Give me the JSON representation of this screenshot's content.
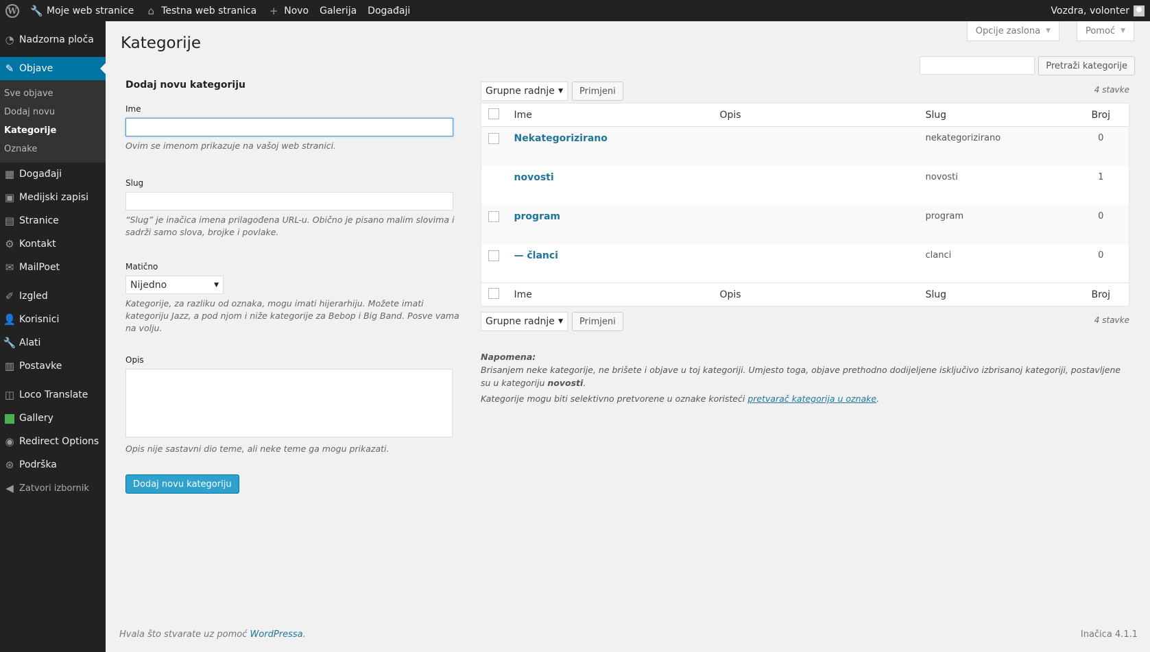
{
  "adminbar": {
    "site_name": "Moje web stranice",
    "site_link": "Testna web stranica",
    "new": "Novo",
    "gallery": "Galerija",
    "events": "Događaji",
    "user": "Vozdra, volonter"
  },
  "sidebar": {
    "dashboard": "Nadzorna ploča",
    "posts": "Objave",
    "sub": [
      "Sve objave",
      "Dodaj novu",
      "Kategorije",
      "Oznake"
    ],
    "events": "Događaji",
    "media": "Medijski zapisi",
    "pages": "Stranice",
    "contact": "Kontakt",
    "mailpoet": "MailPoet",
    "appearance": "Izgled",
    "users": "Korisnici",
    "tools": "Alati",
    "settings": "Postavke",
    "loco": "Loco Translate",
    "gallery": "Gallery",
    "redirect": "Redirect Options",
    "support": "Podrška",
    "collapse": "Zatvori izbornik"
  },
  "header": {
    "screen_options": "Opcije zaslona",
    "help": "Pomoć",
    "title": "Kategorije",
    "search_button": "Pretraži kategorije",
    "search_value": ""
  },
  "form": {
    "title": "Dodaj novu kategoriju",
    "name_label": "Ime",
    "name_value": "",
    "name_desc": "Ovim se imenom prikazuje na vašoj web stranici.",
    "slug_label": "Slug",
    "slug_value": "",
    "slug_desc": "“Slug” je inačica imena prilagođena URL-u. Obično je pisano malim slovima i sadrži samo slova, brojke i povlake.",
    "parent_label": "Matično",
    "parent_value": "Nijedno",
    "parent_desc": "Kategorije, za razliku od oznaka, mogu imati hijerarhiju. Možete imati kategoriju Jazz, a pod njom i niže kategorije za Bebop i Big Band. Posve vama na volju.",
    "desc_label": "Opis",
    "desc_desc": "Opis nije sastavni dio teme, ali neke teme ga mogu prikazati.",
    "submit": "Dodaj novu kategoriju"
  },
  "list": {
    "bulk_label": "Grupne radnje",
    "apply": "Primjeni",
    "count": "4 stavke",
    "columns": {
      "name": "Ime",
      "description": "Opis",
      "slug": "Slug",
      "count": "Broj"
    },
    "rows": [
      {
        "name": "Nekategorizirano",
        "description": "",
        "slug": "nekategorizirano",
        "count": "0"
      },
      {
        "name": "novosti",
        "description": "",
        "slug": "novosti",
        "count": "1"
      },
      {
        "name": "program",
        "description": "",
        "slug": "program",
        "count": "0"
      },
      {
        "name": "— članci",
        "description": "",
        "slug": "clanci",
        "count": "0"
      }
    ]
  },
  "note": {
    "label": "Napomena:",
    "text1": "Brisanjem neke kategorije, ne brišete i objave u toj kategoriji. Umjesto toga, objave prethodno dodijeljene isključivo izbrisanoj kategoriji, postavljene su u kategoriju",
    "text1_bold": "novosti",
    "text2_before": "Kategorije mogu biti selektivno pretvorene u oznake koristeći",
    "text2_link": "pretvarač kategorija u oznake"
  },
  "footer": {
    "thanks": "Hvala što stvarate uz pomoć",
    "wp": "WordPressa",
    "version": "Inačica 4.1.1"
  },
  "colors": {
    "accent": "#0074a2",
    "primary_button": "#2ea2cc",
    "link": "#21759b",
    "sidebar": "#222222"
  }
}
